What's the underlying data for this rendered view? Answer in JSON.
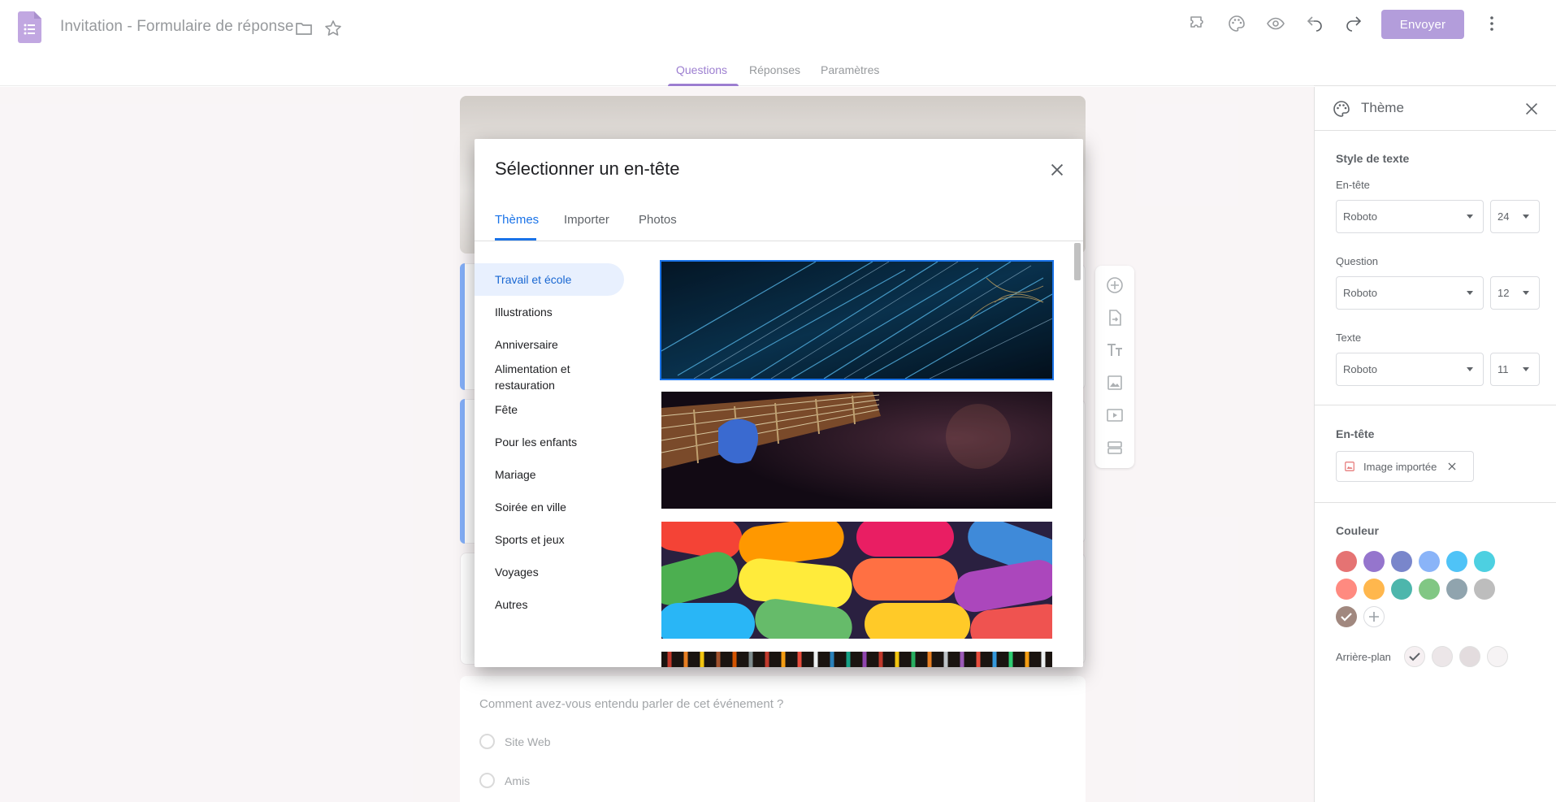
{
  "app": {
    "title": "Invitation - Formulaire de réponse",
    "send_label": "Envoyer",
    "tabs": [
      "Questions",
      "Réponses",
      "Paramètres"
    ],
    "active_tab": "Questions",
    "accent_color": "#673ab7"
  },
  "toolbar_icons": [
    "folder-icon",
    "star-icon",
    "addon-icon",
    "palette-icon",
    "preview-icon",
    "undo-icon",
    "redo-icon",
    "more-icon"
  ],
  "form": {
    "question": "Comment avez-vous entendu parler de cet événement ?",
    "options": [
      "Site Web",
      "Amis"
    ]
  },
  "float_toolbar": [
    "add-question-icon",
    "import-questions-icon",
    "title-icon",
    "image-icon",
    "video-icon",
    "section-icon"
  ],
  "dialog": {
    "title": "Sélectionner un en-tête",
    "tabs": [
      "Thèmes",
      "Importer",
      "Photos"
    ],
    "active_tab": "Thèmes",
    "categories": [
      "Travail et école",
      "Illustrations",
      "Anniversaire",
      "Alimentation et restauration",
      "Fête",
      "Pour les enfants",
      "Mariage",
      "Soirée en ville",
      "Sports et jeux",
      "Voyages",
      "Autres"
    ],
    "active_category": "Travail et école",
    "images": [
      "fiber-optics-image",
      "guitar-image",
      "candy-image",
      "yarn-image"
    ]
  },
  "theme_panel": {
    "title": "Thème",
    "text_style_heading": "Style de texte",
    "header_label": "En-tête",
    "header_font": "Roboto",
    "header_size": "24",
    "question_label": "Question",
    "question_font": "Roboto",
    "question_size": "12",
    "text_label": "Texte",
    "text_font": "Roboto",
    "text_size": "11",
    "header_section": "En-tête",
    "header_chip": "Image importée",
    "color_section": "Couleur",
    "colors": [
      "#e57373",
      "#9575cd",
      "#7986cb",
      "#8ab4f8",
      "#4fc3f7",
      "#4dd0e1",
      "#ff8a80",
      "#ffb74d",
      "#4db6ac",
      "#81c784",
      "#90a4ae",
      "#bdbdbd",
      "#a1887f"
    ],
    "selected_color": "#a1887f",
    "background_label": "Arrière-plan",
    "backgrounds": [
      "#f6f0f2",
      "#ece6e8",
      "#e3dcde",
      "#f6f3f4"
    ]
  }
}
